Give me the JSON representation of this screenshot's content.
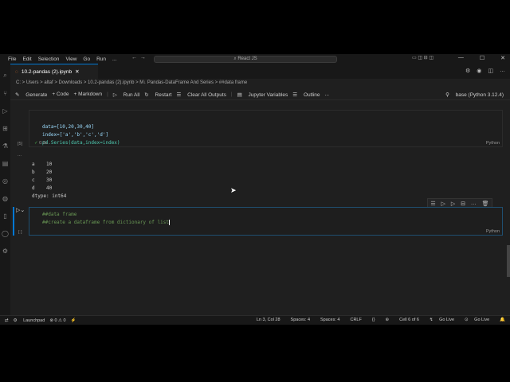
{
  "menu": [
    "File",
    "Edit",
    "Selection",
    "View",
    "Go",
    "Run",
    "..."
  ],
  "search": "React JS",
  "tab": {
    "title": "10.2-pandas (2).ipynb"
  },
  "breadcrumb": "C: > Users > altaf > Downloads > 10.2-pandas (2).ipynb > M↓ Pandas-DataFrame And Series > ##data frame",
  "toolbar": {
    "generate": "Generate",
    "code": "+ Code",
    "markdown": "+ Markdown",
    "run_all": "Run All",
    "restart": "Restart",
    "clear": "Clear All Outputs",
    "variables": "Jupyter Variables",
    "outline": "Outline",
    "more": "...",
    "kernel": "base (Python 3.12.4)"
  },
  "cell1": {
    "lines": [
      "data=[10,20,30,40]",
      "index=['a','b','c','d']",
      "pd.Series(data,index=index)"
    ],
    "exec": "[5]",
    "time": "0.0s",
    "lang": "Python"
  },
  "output": {
    "lines": [
      "a    10",
      "b    20",
      "c    30",
      "d    40",
      "dtype: int64"
    ],
    "dots": "..."
  },
  "cell2": {
    "lines": [
      "##data frame",
      "##create a dataframe from dictionary of list"
    ],
    "exec": "[ ]",
    "lang": "Python"
  },
  "status": {
    "launchpad": "Launchpad",
    "problems": "⊗ 0 ⚠ 0",
    "pos": "Ln 3, Col 28",
    "spaces1": "Spaces: 4",
    "spaces2": "Spaces: 4",
    "eol": "CRLF",
    "braces": "{}",
    "cell": "Cell 6 of 6",
    "golive1": "Go Live",
    "golive2": "Go Live"
  }
}
